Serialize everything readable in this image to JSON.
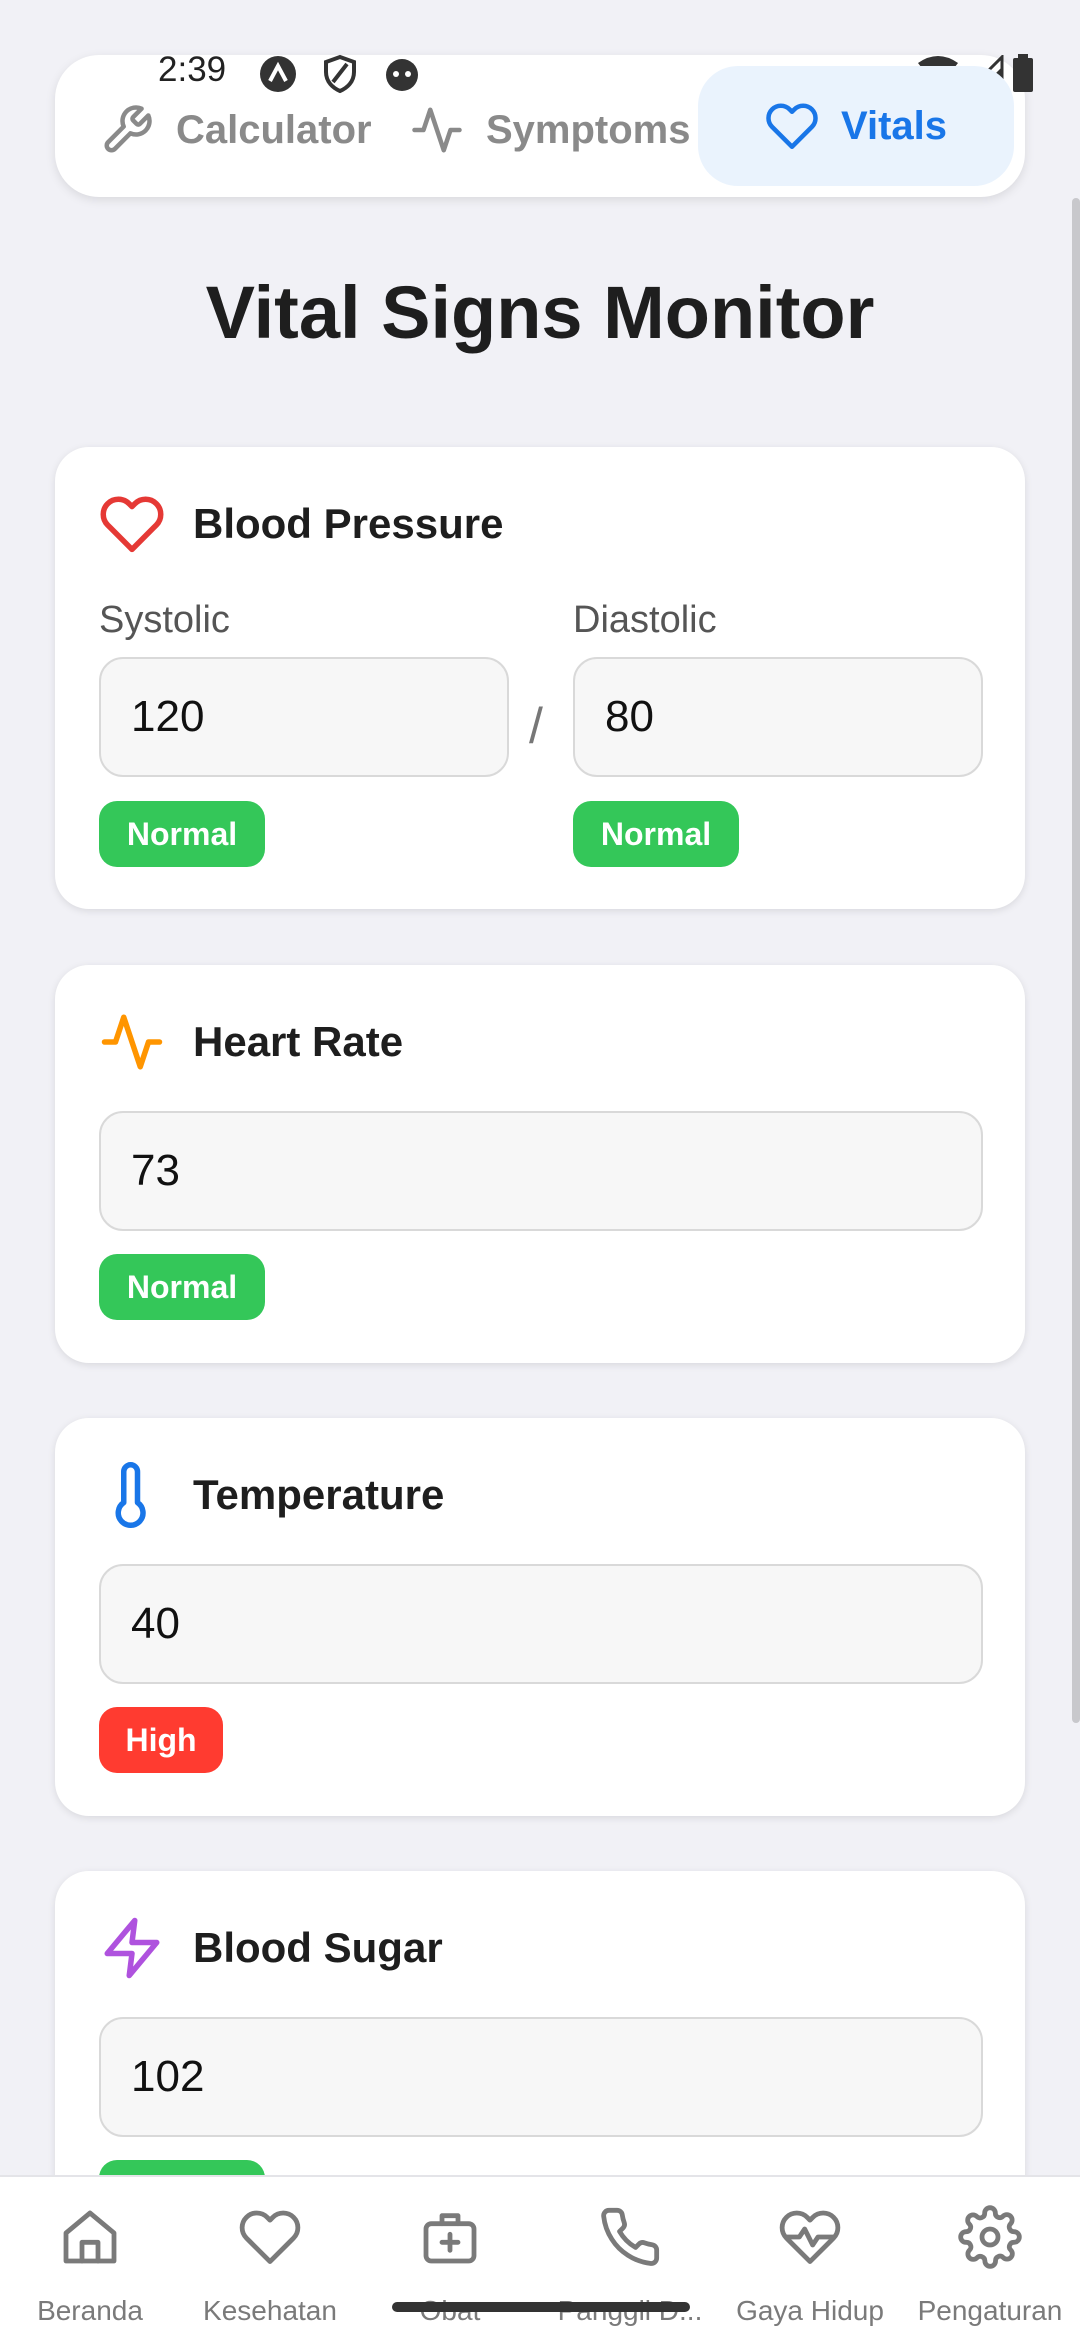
{
  "status_bar": {
    "time": "2:39"
  },
  "tabs": [
    {
      "label": "Calculator",
      "icon": "wrench-icon"
    },
    {
      "label": "Symptoms",
      "icon": "activity-icon"
    },
    {
      "label": "Vitals",
      "icon": "heart-icon",
      "active": true
    }
  ],
  "page_title": "Vital Signs Monitor",
  "vitals": {
    "blood_pressure": {
      "title": "Blood Pressure",
      "systolic_label": "Systolic",
      "systolic_value": "120",
      "systolic_status": "Normal",
      "separator": "/",
      "diastolic_label": "Diastolic",
      "diastolic_value": "80",
      "diastolic_status": "Normal"
    },
    "heart_rate": {
      "title": "Heart Rate",
      "value": "73",
      "status": "Normal"
    },
    "temperature": {
      "title": "Temperature",
      "value": "40",
      "status": "High"
    },
    "blood_sugar": {
      "title": "Blood Sugar",
      "value": "102"
    }
  },
  "bottom_nav": [
    {
      "label": "Beranda",
      "icon": "home-icon"
    },
    {
      "label": "Kesehatan",
      "icon": "heart-icon"
    },
    {
      "label": "Obat",
      "icon": "medkit-icon"
    },
    {
      "label": "Panggil D...",
      "icon": "phone-icon"
    },
    {
      "label": "Gaya Hidup",
      "icon": "heartbeat-icon"
    },
    {
      "label": "Pengaturan",
      "icon": "gear-icon"
    }
  ],
  "colors": {
    "accent": "#1976E8",
    "normal": "#34C759",
    "high": "#FF3B30",
    "heart_red": "#E53935",
    "heart_rate_orange": "#FF9500",
    "temperature_blue": "#1976E8",
    "sugar_purple": "#AF52DE"
  }
}
